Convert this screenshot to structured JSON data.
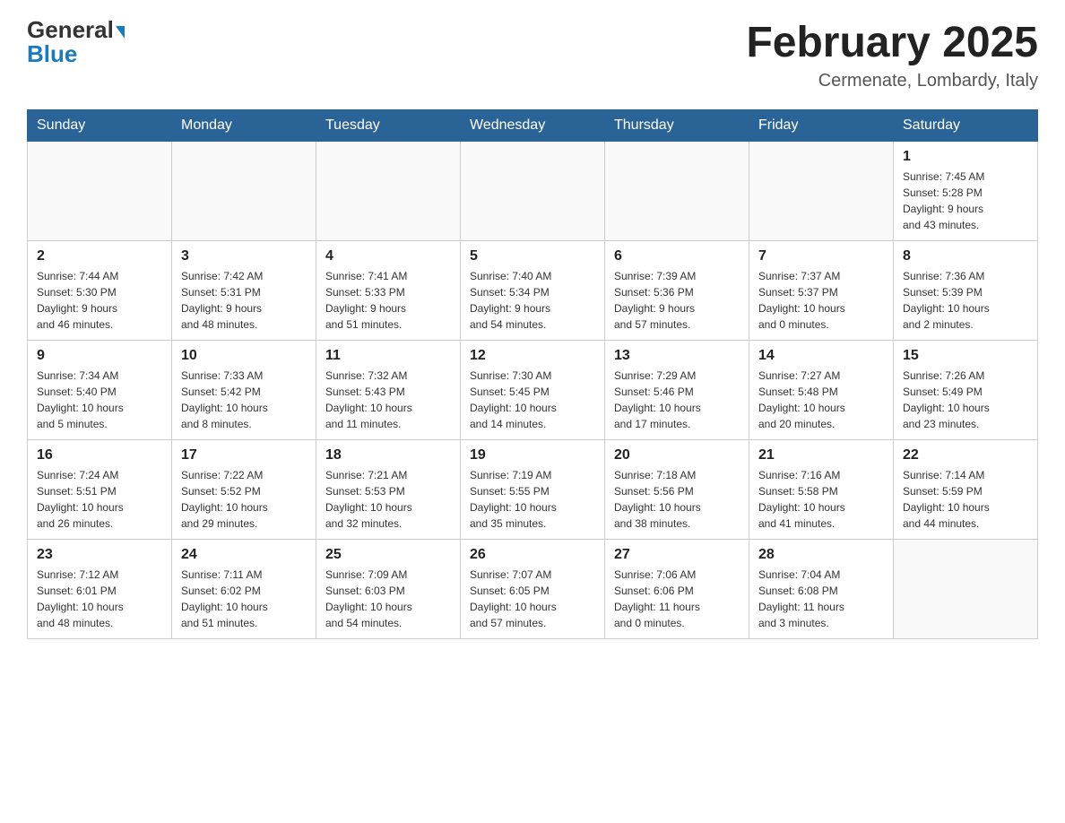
{
  "header": {
    "logo_general": "General",
    "logo_blue": "Blue",
    "month_title": "February 2025",
    "location": "Cermenate, Lombardy, Italy"
  },
  "weekdays": [
    "Sunday",
    "Monday",
    "Tuesday",
    "Wednesday",
    "Thursday",
    "Friday",
    "Saturday"
  ],
  "weeks": [
    [
      {
        "num": "",
        "info": ""
      },
      {
        "num": "",
        "info": ""
      },
      {
        "num": "",
        "info": ""
      },
      {
        "num": "",
        "info": ""
      },
      {
        "num": "",
        "info": ""
      },
      {
        "num": "",
        "info": ""
      },
      {
        "num": "1",
        "info": "Sunrise: 7:45 AM\nSunset: 5:28 PM\nDaylight: 9 hours\nand 43 minutes."
      }
    ],
    [
      {
        "num": "2",
        "info": "Sunrise: 7:44 AM\nSunset: 5:30 PM\nDaylight: 9 hours\nand 46 minutes."
      },
      {
        "num": "3",
        "info": "Sunrise: 7:42 AM\nSunset: 5:31 PM\nDaylight: 9 hours\nand 48 minutes."
      },
      {
        "num": "4",
        "info": "Sunrise: 7:41 AM\nSunset: 5:33 PM\nDaylight: 9 hours\nand 51 minutes."
      },
      {
        "num": "5",
        "info": "Sunrise: 7:40 AM\nSunset: 5:34 PM\nDaylight: 9 hours\nand 54 minutes."
      },
      {
        "num": "6",
        "info": "Sunrise: 7:39 AM\nSunset: 5:36 PM\nDaylight: 9 hours\nand 57 minutes."
      },
      {
        "num": "7",
        "info": "Sunrise: 7:37 AM\nSunset: 5:37 PM\nDaylight: 10 hours\nand 0 minutes."
      },
      {
        "num": "8",
        "info": "Sunrise: 7:36 AM\nSunset: 5:39 PM\nDaylight: 10 hours\nand 2 minutes."
      }
    ],
    [
      {
        "num": "9",
        "info": "Sunrise: 7:34 AM\nSunset: 5:40 PM\nDaylight: 10 hours\nand 5 minutes."
      },
      {
        "num": "10",
        "info": "Sunrise: 7:33 AM\nSunset: 5:42 PM\nDaylight: 10 hours\nand 8 minutes."
      },
      {
        "num": "11",
        "info": "Sunrise: 7:32 AM\nSunset: 5:43 PM\nDaylight: 10 hours\nand 11 minutes."
      },
      {
        "num": "12",
        "info": "Sunrise: 7:30 AM\nSunset: 5:45 PM\nDaylight: 10 hours\nand 14 minutes."
      },
      {
        "num": "13",
        "info": "Sunrise: 7:29 AM\nSunset: 5:46 PM\nDaylight: 10 hours\nand 17 minutes."
      },
      {
        "num": "14",
        "info": "Sunrise: 7:27 AM\nSunset: 5:48 PM\nDaylight: 10 hours\nand 20 minutes."
      },
      {
        "num": "15",
        "info": "Sunrise: 7:26 AM\nSunset: 5:49 PM\nDaylight: 10 hours\nand 23 minutes."
      }
    ],
    [
      {
        "num": "16",
        "info": "Sunrise: 7:24 AM\nSunset: 5:51 PM\nDaylight: 10 hours\nand 26 minutes."
      },
      {
        "num": "17",
        "info": "Sunrise: 7:22 AM\nSunset: 5:52 PM\nDaylight: 10 hours\nand 29 minutes."
      },
      {
        "num": "18",
        "info": "Sunrise: 7:21 AM\nSunset: 5:53 PM\nDaylight: 10 hours\nand 32 minutes."
      },
      {
        "num": "19",
        "info": "Sunrise: 7:19 AM\nSunset: 5:55 PM\nDaylight: 10 hours\nand 35 minutes."
      },
      {
        "num": "20",
        "info": "Sunrise: 7:18 AM\nSunset: 5:56 PM\nDaylight: 10 hours\nand 38 minutes."
      },
      {
        "num": "21",
        "info": "Sunrise: 7:16 AM\nSunset: 5:58 PM\nDaylight: 10 hours\nand 41 minutes."
      },
      {
        "num": "22",
        "info": "Sunrise: 7:14 AM\nSunset: 5:59 PM\nDaylight: 10 hours\nand 44 minutes."
      }
    ],
    [
      {
        "num": "23",
        "info": "Sunrise: 7:12 AM\nSunset: 6:01 PM\nDaylight: 10 hours\nand 48 minutes."
      },
      {
        "num": "24",
        "info": "Sunrise: 7:11 AM\nSunset: 6:02 PM\nDaylight: 10 hours\nand 51 minutes."
      },
      {
        "num": "25",
        "info": "Sunrise: 7:09 AM\nSunset: 6:03 PM\nDaylight: 10 hours\nand 54 minutes."
      },
      {
        "num": "26",
        "info": "Sunrise: 7:07 AM\nSunset: 6:05 PM\nDaylight: 10 hours\nand 57 minutes."
      },
      {
        "num": "27",
        "info": "Sunrise: 7:06 AM\nSunset: 6:06 PM\nDaylight: 11 hours\nand 0 minutes."
      },
      {
        "num": "28",
        "info": "Sunrise: 7:04 AM\nSunset: 6:08 PM\nDaylight: 11 hours\nand 3 minutes."
      },
      {
        "num": "",
        "info": ""
      }
    ]
  ]
}
